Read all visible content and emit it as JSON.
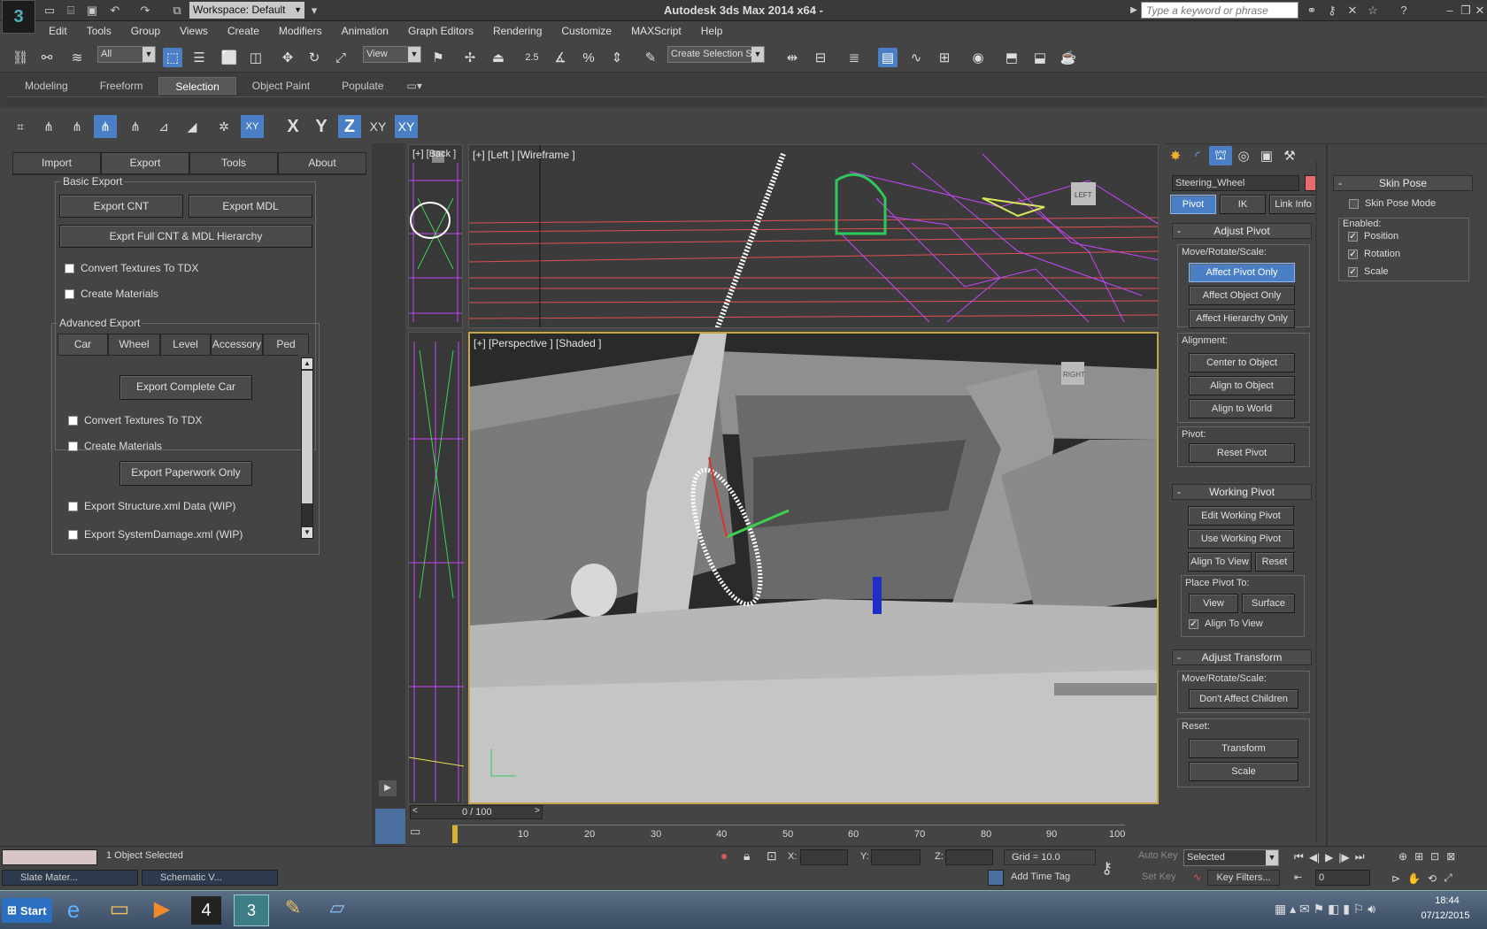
{
  "app": {
    "title": "Autodesk 3ds Max  2014 x64  -",
    "workspace": "Workspace: Default",
    "search_placeholder": "Type a keyword or phrase"
  },
  "menu": [
    "Edit",
    "Tools",
    "Group",
    "Views",
    "Create",
    "Modifiers",
    "Animation",
    "Graph Editors",
    "Rendering",
    "Customize",
    "MAXScript",
    "Help"
  ],
  "toolbar": {
    "filter": "All",
    "ref_coord": "View",
    "selection_set": "Create Selection Se",
    "snap_25": "2.5",
    "pct": "%"
  },
  "ribbon_tabs": [
    "Modeling",
    "Freeform",
    "Selection",
    "Object Paint",
    "Populate"
  ],
  "ribbon_selected": "Selection",
  "snap_axes": [
    "X",
    "Y",
    "Z",
    "XY",
    "XY"
  ],
  "left_panel": {
    "tabs": [
      "Import",
      "Export",
      "Tools",
      "About"
    ],
    "selected_tab": "Export",
    "basic_export": {
      "title": "Basic Export",
      "export_cnt": "Export CNT",
      "export_mdl": "Export MDL",
      "export_full": "Exprt Full CNT & MDL Hierarchy",
      "convert_textures": "Convert Textures To TDX",
      "create_materials": "Create Materials"
    },
    "advanced_export": {
      "title": "Advanced Export",
      "tabs": [
        "Car",
        "Wheel",
        "Level",
        "Accessory",
        "Ped"
      ],
      "selected_tab": "Car",
      "export_complete_car": "Export Complete Car",
      "convert_textures": "Convert Textures To TDX",
      "create_materials": "Create Materials",
      "export_paperwork": "Export Paperwork Only",
      "export_structure": "Export Structure.xml Data (WIP)",
      "export_system_damage": "Export SystemDamage.xml (WIP)"
    }
  },
  "viewports": {
    "back": "[+] [Back ]",
    "left": "[+] [Left ] [Wireframe ]",
    "perspective": "[+] [Perspective ] [Shaded ]",
    "left_cube": "LEFT",
    "persp_cube": "RIGHT"
  },
  "command_panel": {
    "object_name": "Steering_Wheel",
    "object_color": "#e86a6a",
    "hier_tabs": [
      "Pivot",
      "IK",
      "Link Info"
    ],
    "hier_selected": "Pivot",
    "adjust_pivot": {
      "title": "Adjust Pivot",
      "move_label": "Move/Rotate/Scale:",
      "affect_pivot": "Affect Pivot Only",
      "affect_object": "Affect Object Only",
      "affect_hierarchy": "Affect Hierarchy Only",
      "alignment_label": "Alignment:",
      "center_to_object": "Center to Object",
      "align_to_object": "Align to Object",
      "align_to_world": "Align to World",
      "pivot_label": "Pivot:",
      "reset_pivot": "Reset Pivot"
    },
    "working_pivot": {
      "title": "Working Pivot",
      "edit": "Edit Working Pivot",
      "use": "Use Working Pivot",
      "align_to_view": "Align To View",
      "reset": "Reset",
      "place_label": "Place Pivot To:",
      "view": "View",
      "surface": "Surface",
      "align_check": "Align To View"
    },
    "adjust_transform": {
      "title": "Adjust Transform",
      "move_label": "Move/Rotate/Scale:",
      "dont_affect": "Don't Affect Children",
      "reset_label": "Reset:",
      "transform": "Transform",
      "scale": "Scale"
    },
    "skin_pose": {
      "title": "Skin Pose",
      "mode": "Skin Pose Mode",
      "enabled_label": "Enabled:",
      "position": "Position",
      "rotation": "Rotation",
      "scale": "Scale"
    }
  },
  "timeline": {
    "frame": "0 / 100",
    "ticks": [
      "10",
      "20",
      "30",
      "40",
      "50",
      "60",
      "70",
      "80",
      "90",
      "100"
    ]
  },
  "status": {
    "selected": "1 Object Selected",
    "x_label": "X:",
    "y_label": "Y:",
    "z_label": "Z:",
    "grid": "Grid = 10.0",
    "auto_key": "Auto Key",
    "set_key": "Set Key",
    "key_mode": "Selected",
    "key_filters": "Key Filters...",
    "add_time_tag": "Add Time Tag",
    "frame_field": "0",
    "mini1": "Slate Mater...",
    "mini2": "Schematic V..."
  },
  "taskbar": {
    "start": "Start",
    "time": "18:44",
    "date": "07/12/2015"
  }
}
